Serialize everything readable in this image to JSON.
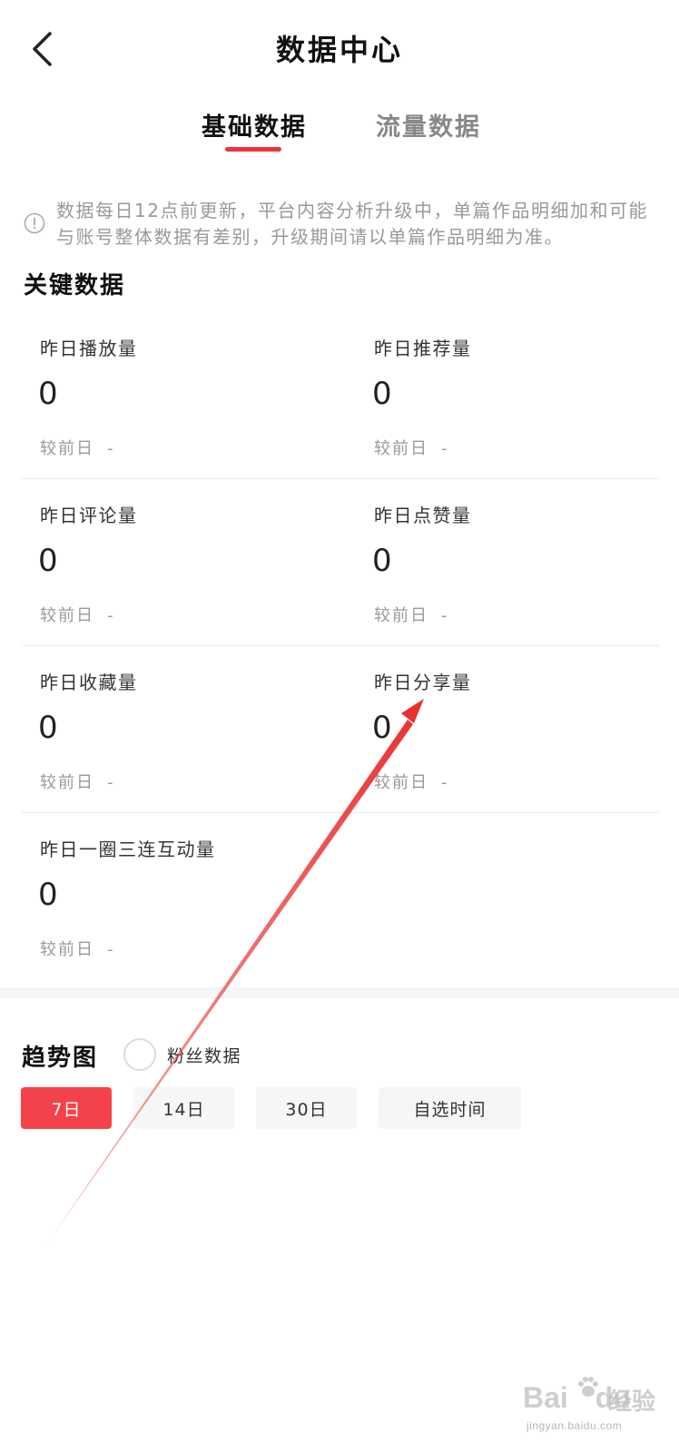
{
  "header": {
    "title": "数据中心"
  },
  "tabs": [
    {
      "label": "基础数据",
      "active": true
    },
    {
      "label": "流量数据",
      "active": false
    }
  ],
  "notice": {
    "text": "数据每日12点前更新，平台内容分析升级中，单篇作品明细加和可能与账号整体数据有差别，升级期间请以单篇作品明细为准。"
  },
  "key_data": {
    "title": "关键数据",
    "compare_label": "较前日",
    "metrics": [
      {
        "label": "昨日播放量",
        "value": "0",
        "change": "-"
      },
      {
        "label": "昨日推荐量",
        "value": "0",
        "change": "-"
      },
      {
        "label": "昨日评论量",
        "value": "0",
        "change": "-"
      },
      {
        "label": "昨日点赞量",
        "value": "0",
        "change": "-"
      },
      {
        "label": "昨日收藏量",
        "value": "0",
        "change": "-"
      },
      {
        "label": "昨日分享量",
        "value": "0",
        "change": "-"
      },
      {
        "label": "昨日一圈三连互动量",
        "value": "0",
        "change": "-"
      }
    ]
  },
  "trend": {
    "title": "趋势图",
    "fans_toggle_label": "粉丝数据",
    "ranges": [
      {
        "label": "7日",
        "active": true
      },
      {
        "label": "14日",
        "active": false
      },
      {
        "label": "30日",
        "active": false
      },
      {
        "label": "自选时间",
        "active": false
      }
    ]
  },
  "watermark": {
    "brand": "Bai",
    "brand2": "du",
    "cn": "经验",
    "url": "jingyan.baidu.com"
  },
  "colors": {
    "accent": "#f0323c",
    "arrow": "#e8302e",
    "muted": "#999999"
  }
}
